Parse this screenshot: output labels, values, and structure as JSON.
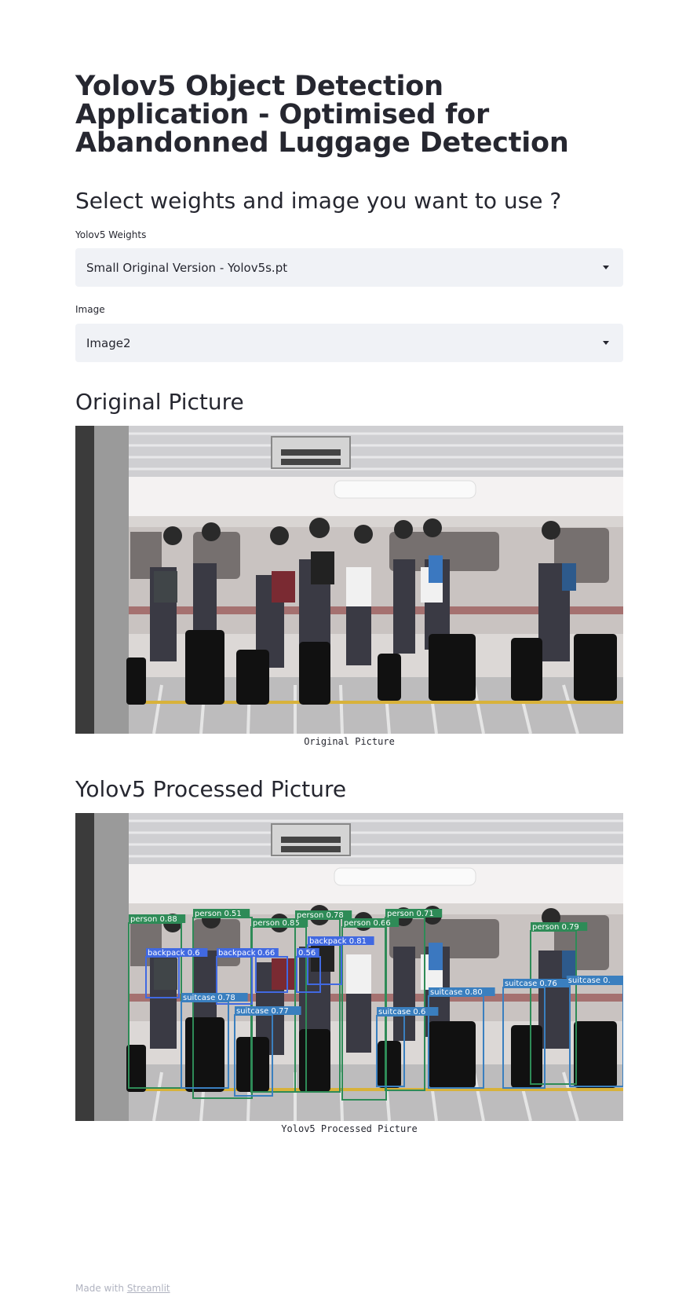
{
  "title": "Yolov5 Object Detection Application - Optimised for Abandonned Luggage Detection",
  "select_header": "Select weights and image you want to use ?",
  "weights": {
    "label": "Yolov5 Weights",
    "value": "Small Original Version - Yolov5s.pt"
  },
  "image": {
    "label": "Image",
    "value": "Image2"
  },
  "original": {
    "header": "Original Picture",
    "caption": "Original Picture"
  },
  "processed": {
    "header": "Yolov5 Processed Picture",
    "caption": "Yolov5 Processed Picture",
    "detections": [
      {
        "label": "person 0.88",
        "class": "person"
      },
      {
        "label": "person 0.51",
        "class": "person"
      },
      {
        "label": "person 0.85",
        "class": "person"
      },
      {
        "label": "person 0.78",
        "class": "person"
      },
      {
        "label": "person 0.66",
        "class": "person"
      },
      {
        "label": "person 0.71",
        "class": "person"
      },
      {
        "label": "person 0.79",
        "class": "person"
      },
      {
        "label": "backpack 0.6",
        "class": "backpack"
      },
      {
        "label": "backpack",
        "class": "backpack"
      },
      {
        "label": "0.66",
        "class": "backpack"
      },
      {
        "label": "backpack 0.81",
        "class": "backpack"
      },
      {
        "label": "0.56",
        "class": "backpack"
      },
      {
        "label": "suitcase 0.78",
        "class": "suitcase"
      },
      {
        "label": "suitcase 0.77",
        "class": "suitcase"
      },
      {
        "label": "suitcase 0.6",
        "class": "suitcase"
      },
      {
        "label": "suitcase 0.80",
        "class": "suitcase"
      },
      {
        "label": "suitcase 0.76",
        "class": "suitcase"
      },
      {
        "label": "suitcase 0.",
        "class": "suitcase"
      }
    ]
  },
  "colors": {
    "person": "#2e8b57",
    "backpack": "#4169e1",
    "suitcase": "#3a7fbf"
  },
  "footer": {
    "prefix": "Made with",
    "link": "Streamlit"
  }
}
